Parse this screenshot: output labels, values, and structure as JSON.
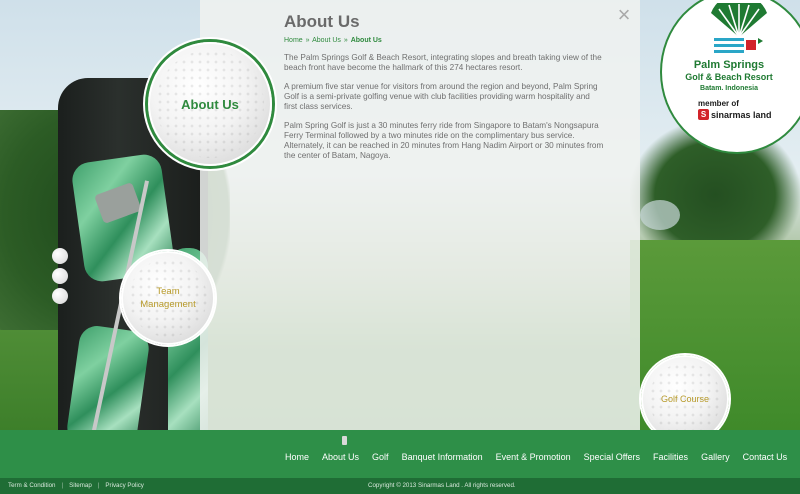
{
  "page": {
    "title": "About Us"
  },
  "breadcrumb": {
    "home": "Home",
    "separator": "»",
    "parent": "About Us",
    "current": "About Us"
  },
  "close": {
    "label": "×"
  },
  "content": {
    "paragraphs": [
      "The Palm Springs Golf & Beach Resort, integrating slopes and breath taking view of the beach front have become the hallmark of this 274 hectares resort.",
      "A premium five star venue for visitors from around the region and beyond, Palm Spring Golf is a semi-private golfing venue with club facilities providing warm hospitality and first class services.",
      "Palm Spring Golf is just a 30 minutes ferry ride from Singapore to Batam's Nongsapura Ferry Terminal followed by a two minutes ride on the complimentary bus service. Alternately, it can be reached in 20 minutes from Hang Nadim Airport or 30 minutes from the center of Batam, Nagoya."
    ]
  },
  "balls": {
    "about": "About Us",
    "team_line1": "Team",
    "team_line2": "Management",
    "golf_course": "Golf Course"
  },
  "logo": {
    "name_line1": "Palm Springs",
    "name_line2": "Golf & Beach Resort",
    "location": "Batam. Indonesia",
    "member": "member of",
    "brand": "sinarmas land",
    "brand_icon": "S",
    "icon": "palm-fan-logo-icon"
  },
  "nav": {
    "items": [
      "Home",
      "About Us",
      "Golf",
      "Banquet Information",
      "Event & Promotion",
      "Special Offers",
      "Facilities",
      "Gallery",
      "Contact Us"
    ]
  },
  "footer": {
    "term": "Term & Condition",
    "sitemap": "Sitemap",
    "privacy": "Privacy Policy",
    "pipe": "|",
    "copyright": "Copyright © 2013  Sinarmas Land . All rights reserved."
  },
  "colors": {
    "accent": "#2f8a3e",
    "nav": "#2e8f48",
    "footer": "#1f6d35"
  }
}
